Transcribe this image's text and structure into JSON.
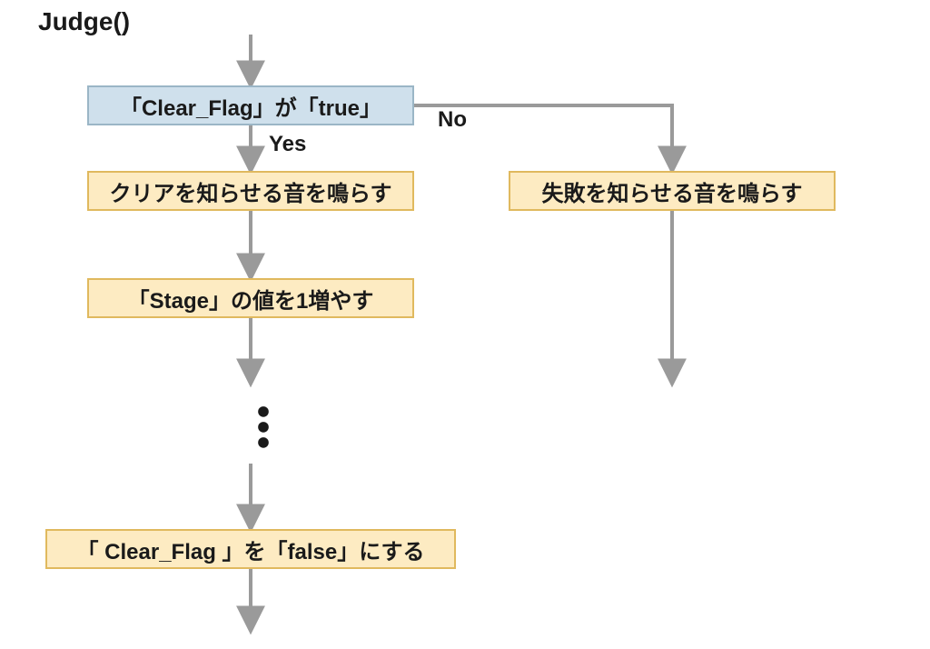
{
  "title": "Judge()",
  "decision": {
    "text": "「Clear_Flag」が「true」",
    "yes": "Yes",
    "no": "No"
  },
  "yes_branch": {
    "step1": "クリアを知らせる音を鳴らす",
    "step2": "「Stage」の値を1増やす",
    "step3": "「 Clear_Flag 」を「false」にする"
  },
  "no_branch": {
    "step1": "失敗を知らせる音を鳴らす"
  }
}
